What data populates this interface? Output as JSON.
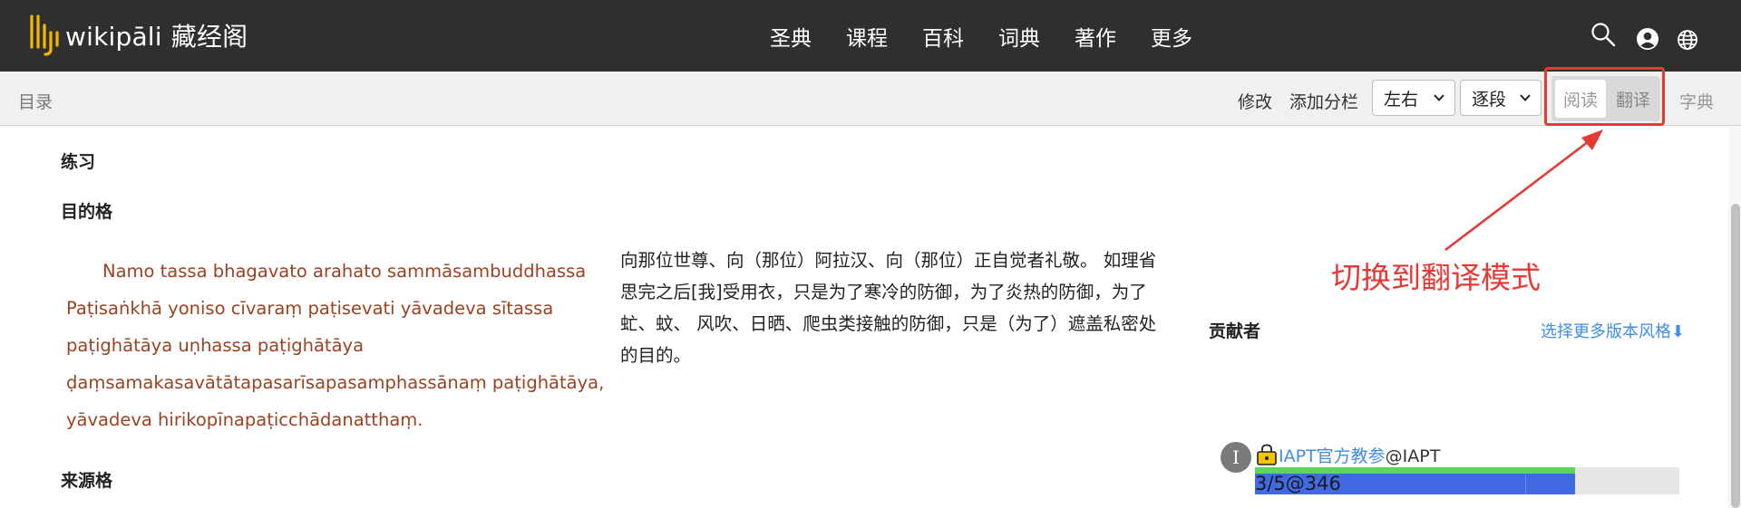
{
  "header": {
    "logo_brand": "wikipāli",
    "logo_cn": "藏经阁",
    "nav": [
      "圣典",
      "课程",
      "百科",
      "词典",
      "著作",
      "更多"
    ],
    "icons": [
      "search-icon",
      "user-icon",
      "globe-icon"
    ]
  },
  "toolbar": {
    "toc_label": "目录",
    "edit_label": "修改",
    "add_column_label": "添加分栏",
    "layout_select": "左右",
    "split_select": "逐段",
    "mode_read": "阅读",
    "mode_translate": "翻译",
    "dict_label": "字典"
  },
  "content": {
    "section_exercise": "练习",
    "section_purpose": "目的格",
    "section_source": "来源格",
    "pali_lines": [
      "Namo tassa bhagavato arahato sammāsambuddhassa",
      "Paṭisaṅkhā yoniso cīvaraṃ paṭisevati yāvadeva sītassa",
      "paṭighātāya uṇhassa paṭighātāya",
      "ḍaṃsamakasavātātapasarīsapasamphassānaṃ paṭighātāya,",
      "yāvadeva hirikopīnapaṭicchādanatthaṃ."
    ],
    "translation_lines": [
      "向那位世尊、向（那位）阿拉汉、向（那位）正自觉者礼敬。 如理省",
      "思完之后[我]受用衣，只是为了寒冷的防御，为了炎热的防御，为了",
      "虻、蚊、 风吹、日晒、爬虫类接触的防御，只是（为了）遮盖私密处",
      "的目的。"
    ]
  },
  "annotation": {
    "label": "切换到翻译模式",
    "color": "#e53935"
  },
  "contributors": {
    "title": "贡献者",
    "more_versions": "选择更多版本风格⬇",
    "avatar_letter": "I",
    "name": "IAPT官方教参",
    "handle": "@IAPT",
    "progress_text": "3/5@346",
    "progress_fraction": 0.754
  },
  "colors": {
    "header_bg": "#2f2f2f",
    "pali_text": "#9c4221",
    "link": "#3f8de6",
    "progress_blue": "#4169e1",
    "progress_green": "#5cd65c",
    "logo_gold": "#f5b800"
  }
}
